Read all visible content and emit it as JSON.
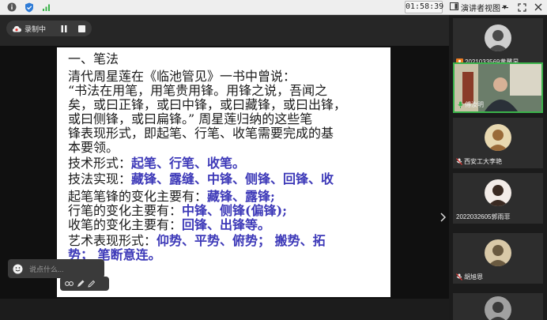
{
  "topbar": {
    "clock": "01:58:39",
    "view_mode_label": "演讲者视图",
    "view_mode_arrow": "▾"
  },
  "recording": {
    "label": "录制中"
  },
  "slide": {
    "lines": [
      {
        "parts": [
          {
            "t": "一、笔法",
            "hl": false
          }
        ]
      },
      {
        "parts": [
          {
            "t": "    清代周星莲在《临池管见》一书中曾说：",
            "hl": false
          }
        ]
      },
      {
        "parts": [
          {
            "t": "  “书法在用笔，用笔贵用锋。用锋之说，吾闻之",
            "hl": false
          }
        ]
      },
      {
        "parts": [
          {
            "t": "矣，或曰正锋，或曰中锋，或曰藏锋，或曰出锋，",
            "hl": false
          }
        ]
      },
      {
        "parts": [
          {
            "t": "或曰侧锋，或曰扁锋。” 周星莲归纳的这些笔",
            "hl": false
          }
        ]
      },
      {
        "parts": [
          {
            "t": "锋表现形式，即起笔、行笔、收笔需要完成的基",
            "hl": false
          }
        ]
      },
      {
        "parts": [
          {
            "t": "本要领。",
            "hl": false
          }
        ]
      },
      {
        "parts": [
          {
            "t": "技术形式：",
            "hl": false
          },
          {
            "t": "起笔、行笔、收笔。",
            "hl": true
          }
        ]
      },
      {
        "parts": [
          {
            "t": "技法实现：",
            "hl": false
          },
          {
            "t": "藏锋、露缝、中锋、侧锋、回锋、收",
            "hl": true
          }
        ]
      },
      {
        "parts": [
          {
            "t": "起笔笔锋的变化主要有：",
            "hl": false
          },
          {
            "t": "藏锋、露锋;",
            "hl": true
          }
        ]
      },
      {
        "parts": [
          {
            "t": "行笔的变化主要有：",
            "hl": false
          },
          {
            "t": "中锋、侧锋(偏锋);",
            "hl": true
          }
        ]
      },
      {
        "parts": [
          {
            "t": "收笔的变化主要有：",
            "hl": false
          },
          {
            "t": "回锋、出锋等。",
            "hl": true
          }
        ]
      },
      {
        "parts": [
          {
            "t": "艺术表现形式：",
            "hl": false
          },
          {
            "t": "仰势、平势、俯势；  搬势、拓",
            "hl": true
          }
        ]
      },
      {
        "parts": [
          {
            "t": "势；  笔断意连。",
            "hl": true
          }
        ]
      }
    ]
  },
  "chat": {
    "placeholder": "说点什么..."
  },
  "participants": [
    {
      "name": "2021033569黄馨昱",
      "icon": "user-icon",
      "active": false
    },
    {
      "name": "傅汝明",
      "icon": "mic-icon",
      "active": true
    },
    {
      "name": "西安工大李艳",
      "icon": "mic-muted-icon",
      "active": false
    },
    {
      "name": "2022032605郭雨菲",
      "icon": "",
      "active": false
    },
    {
      "name": "胡旭恩",
      "icon": "mic-muted-icon",
      "active": false
    },
    {
      "name": "",
      "icon": "",
      "active": false
    }
  ],
  "colors": {
    "highlight": "#3d39b8",
    "active_border": "#3bb34a",
    "user_icon_bg": "#f07c1f"
  }
}
